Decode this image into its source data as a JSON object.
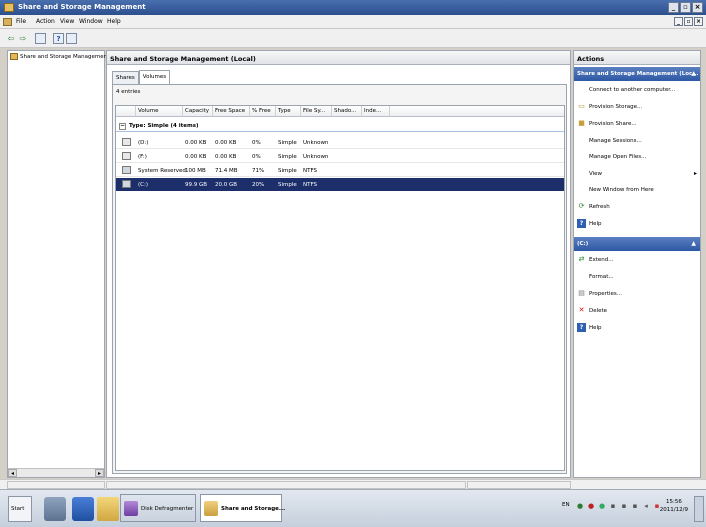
{
  "window": {
    "title": "Share and Storage Management"
  },
  "menubar": {
    "items": [
      "File",
      "Action",
      "View",
      "Window",
      "Help"
    ]
  },
  "tree": {
    "items": [
      {
        "label": "Share and Storage Management ("
      }
    ]
  },
  "center": {
    "header": "Share and Storage Management (Local)",
    "tabs": [
      {
        "label": "Shares"
      },
      {
        "label": "Volumes"
      }
    ],
    "entries": "4 entries",
    "columns": [
      "Volume",
      "Capacity",
      "Free Space",
      "% Free",
      "Type",
      "File Sy...",
      "Shado...",
      "Inde..."
    ],
    "group": "Type: Simple (4 items)",
    "group_toggle": "−",
    "rows": [
      {
        "volume": "(D:)",
        "capacity": "0.00 KB",
        "free": "0.00 KB",
        "pct": "0%",
        "type": "Simple",
        "fs": "Unknown"
      },
      {
        "volume": "(F:)",
        "capacity": "0.00 KB",
        "free": "0.00 KB",
        "pct": "0%",
        "type": "Simple",
        "fs": "Unknown"
      },
      {
        "volume": "System Reserved",
        "capacity": "100 MB",
        "free": "71.4 MB",
        "pct": "71%",
        "type": "Simple",
        "fs": "NTFS"
      },
      {
        "volume": "(C:)",
        "capacity": "99.9 GB",
        "free": "20.0 GB",
        "pct": "20%",
        "type": "Simple",
        "fs": "NTFS"
      }
    ]
  },
  "actions": {
    "title": "Actions",
    "section1": "Share and Storage Management (Loc...",
    "items1": [
      "Connect to another computer...",
      "Provision Storage...",
      "Provision Share...",
      "Manage Sessions...",
      "Manage Open Files...",
      "View",
      "New Window from Here",
      "Refresh",
      "Help"
    ],
    "section2": "(C:)",
    "items2": [
      "Extend...",
      "Format...",
      "Properties...",
      "Delete",
      "Help"
    ]
  },
  "taskbar": {
    "start": "Start",
    "tasks": [
      {
        "label": "Disk Defragmenter"
      },
      {
        "label": "Share and Storage..."
      }
    ],
    "lang": "EN",
    "time": "15:56",
    "date": "2011/12/9"
  }
}
